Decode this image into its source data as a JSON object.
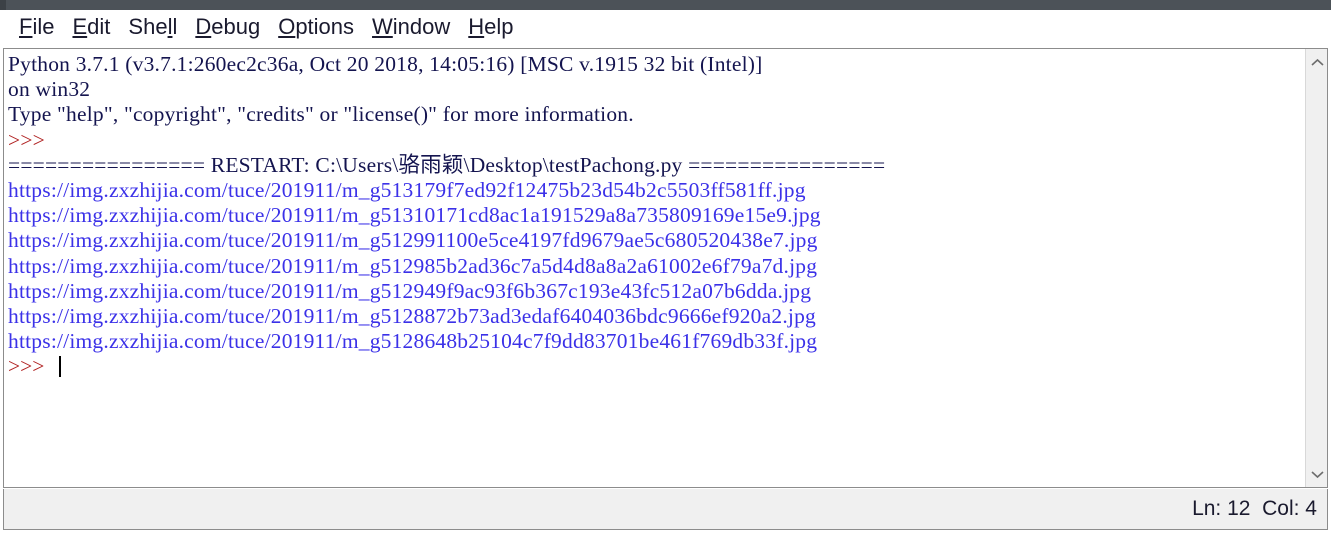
{
  "window": {
    "app": "Python IDLE Shell",
    "titlebar_color": "#4c5258"
  },
  "menubar": {
    "items": [
      {
        "label": "File",
        "accel": "F"
      },
      {
        "label": "Edit",
        "accel": "E"
      },
      {
        "label": "Shell",
        "accel": "l"
      },
      {
        "label": "Debug",
        "accel": "D"
      },
      {
        "label": "Options",
        "accel": "O"
      },
      {
        "label": "Window",
        "accel": "W"
      },
      {
        "label": "Help",
        "accel": "H"
      }
    ]
  },
  "shell": {
    "lines": [
      {
        "kind": "banner",
        "text": "Python 3.7.1 (v3.7.1:260ec2c36a, Oct 20 2018, 14:05:16) [MSC v.1915 32 bit (Intel)]"
      },
      {
        "kind": "banner",
        "text": "on win32"
      },
      {
        "kind": "banner",
        "text": "Type \"help\", \"copyright\", \"credits\" or \"license()\" for more information."
      },
      {
        "kind": "prompt",
        "text": ">>> "
      },
      {
        "kind": "restart",
        "text": "================ RESTART: C:\\Users\\骆雨颖\\Desktop\\testPachong.py ================"
      },
      {
        "kind": "url",
        "text": "https://img.zxzhijia.com/tuce/201911/m_g513179f7ed92f12475b23d54b2c5503ff581ff.jpg"
      },
      {
        "kind": "url",
        "text": "https://img.zxzhijia.com/tuce/201911/m_g51310171cd8ac1a191529a8a735809169e15e9.jpg"
      },
      {
        "kind": "url",
        "text": "https://img.zxzhijia.com/tuce/201911/m_g512991100e5ce4197fd9679ae5c680520438e7.jpg"
      },
      {
        "kind": "url",
        "text": "https://img.zxzhijia.com/tuce/201911/m_g512985b2ad36c7a5d4d8a8a2a61002e6f79a7d.jpg"
      },
      {
        "kind": "url",
        "text": "https://img.zxzhijia.com/tuce/201911/m_g512949f9ac93f6b367c193e43fc512a07b6dda.jpg"
      },
      {
        "kind": "url",
        "text": "https://img.zxzhijia.com/tuce/201911/m_g5128872b73ad3edaf6404036bdc9666ef920a2.jpg"
      },
      {
        "kind": "url",
        "text": "https://img.zxzhijia.com/tuce/201911/m_g5128648b25104c7f9dd83701be461f769db33f.jpg"
      }
    ],
    "active_prompt": ">>> ",
    "input_value": "",
    "colors": {
      "banner": "#14144f",
      "prompt": "#b02020",
      "url": "#3b31e8"
    }
  },
  "scrollbar": {
    "up_arrow": "⌃",
    "down_arrow": "⌄"
  },
  "statusbar": {
    "position": "Ln: 12  Col: 4",
    "line": "12",
    "column": "4"
  }
}
